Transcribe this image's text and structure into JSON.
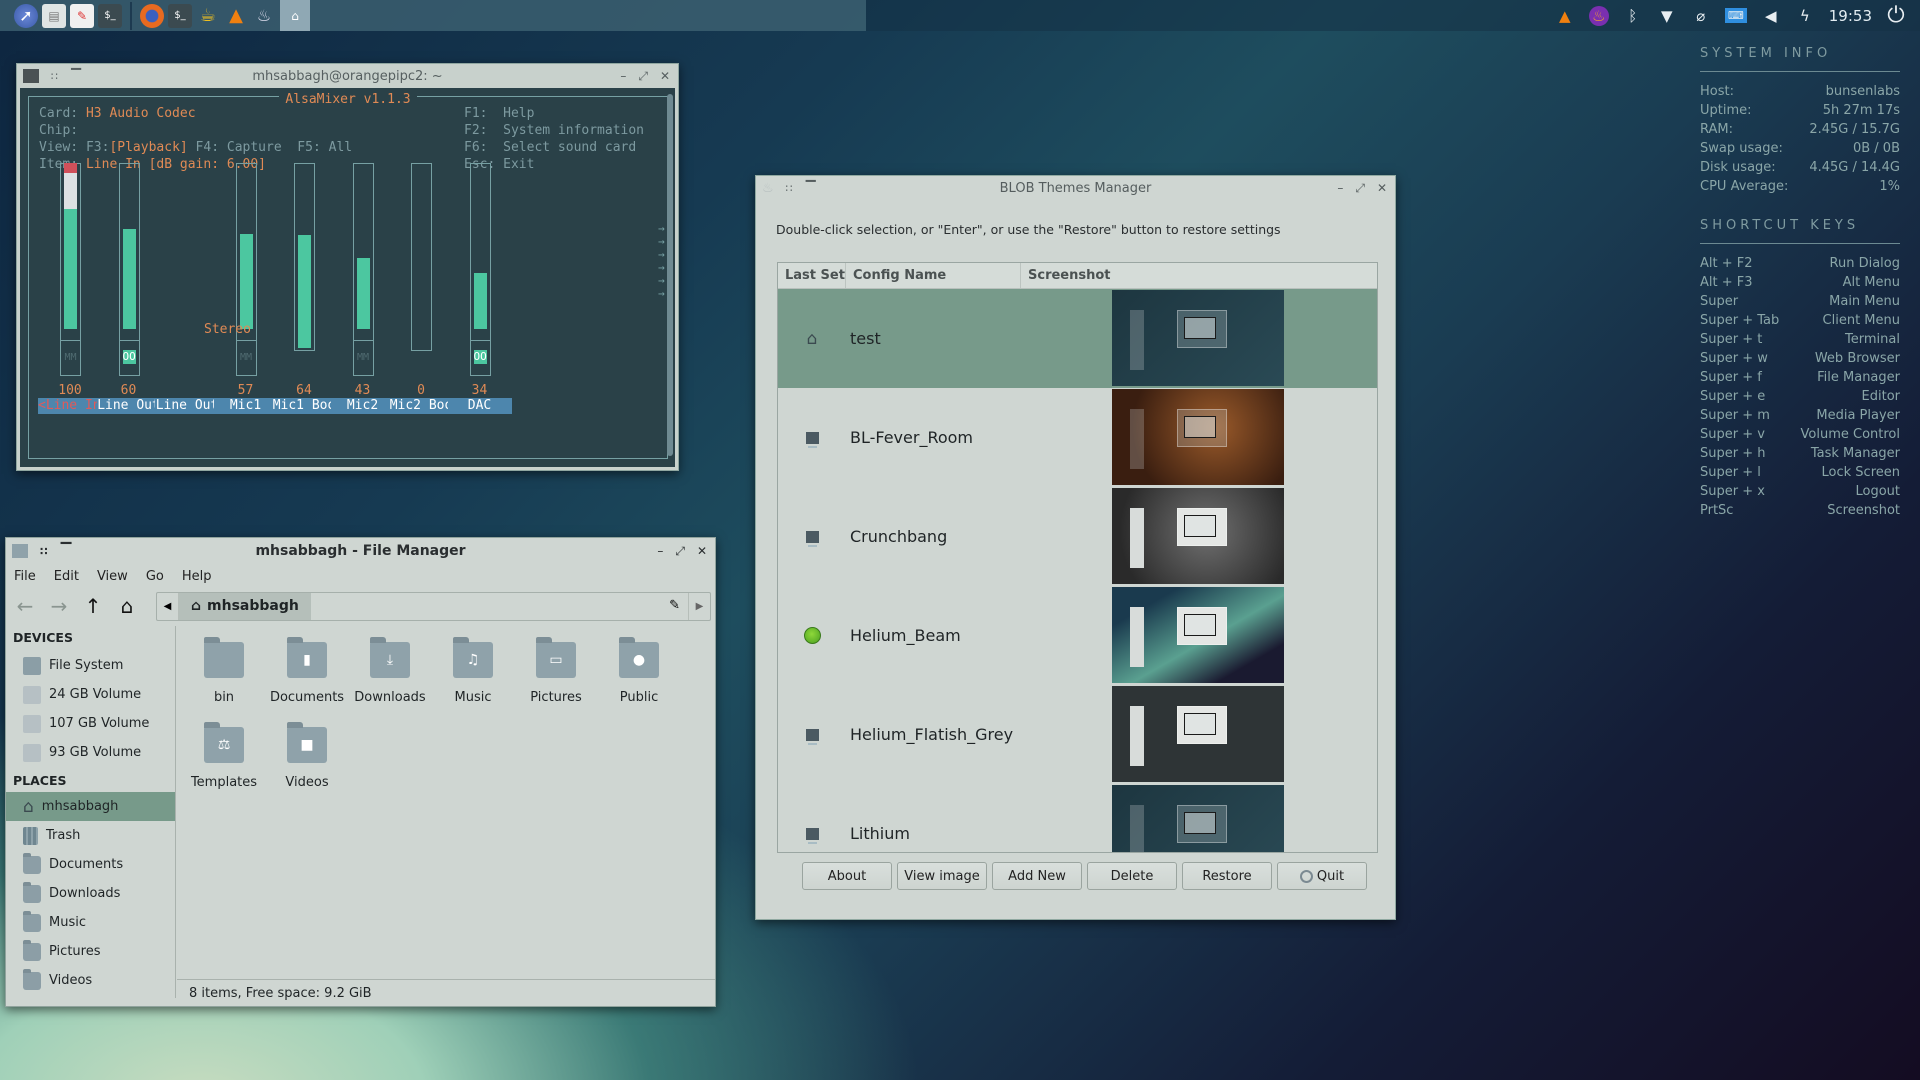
{
  "taskbar": {
    "launchers": [
      "web-browser-icon",
      "file-manager-icon",
      "text-editor-icon",
      "terminal-icon"
    ],
    "apps": [
      "firefox-icon",
      "terminal-icon",
      "conky-icon",
      "vlc-icon",
      "blob-icon",
      "file-manager-icon"
    ],
    "tray": [
      "vlc-icon",
      "flame-app-icon",
      "bluetooth-icon",
      "wifi-icon",
      "clipboard-icon",
      "keyboard-icon",
      "volume-icon",
      "power-manager-icon"
    ],
    "clock": "19:53"
  },
  "conky": {
    "system_title": "SYSTEM INFO",
    "system": [
      {
        "k": "Host:",
        "v": "bunsenlabs"
      },
      {
        "k": "Uptime:",
        "v": "5h 27m 17s"
      },
      {
        "k": "RAM:",
        "v": "2.45G / 15.7G"
      },
      {
        "k": "Swap usage:",
        "v": "0B / 0B"
      },
      {
        "k": "Disk usage:",
        "v": "4.45G / 14.4G"
      },
      {
        "k": "CPU Average:",
        "v": "1%"
      }
    ],
    "shortcuts_title": "SHORTCUT KEYS",
    "shortcuts": [
      {
        "k": "Alt + F2",
        "v": "Run Dialog"
      },
      {
        "k": "Alt + F3",
        "v": "Alt Menu"
      },
      {
        "k": "Super",
        "v": "Main Menu"
      },
      {
        "k": "Super + Tab",
        "v": "Client Menu"
      },
      {
        "k": "Super + t",
        "v": "Terminal"
      },
      {
        "k": "Super + w",
        "v": "Web Browser"
      },
      {
        "k": "Super + f",
        "v": "File Manager"
      },
      {
        "k": "Super + e",
        "v": "Editor"
      },
      {
        "k": "Super + m",
        "v": "Media Player"
      },
      {
        "k": "Super + v",
        "v": "Volume Control"
      },
      {
        "k": "Super + h",
        "v": "Task Manager"
      },
      {
        "k": "Super + l",
        "v": "Lock Screen"
      },
      {
        "k": "Super + x",
        "v": "Logout"
      },
      {
        "k": "PrtSc",
        "v": "Screenshot"
      }
    ]
  },
  "alsa": {
    "window_title": "mhsabbagh@orangepipc2: ~",
    "app_title": "AlsaMixer v1.1.3",
    "card_label": "Card: ",
    "card": "H3 Audio Codec",
    "chip_label": "Chip:",
    "view_label": "View: F3:",
    "view_playback": "[Playback]",
    "view_rest": " F4: Capture  F5: All",
    "item_label": "Item: ",
    "item": "Line In [dB gain: 6.00]",
    "help": [
      "F1:  Help",
      "F2:  System information",
      "F6:  Select sound card",
      "Esc: Exit"
    ],
    "stereo": "Stereo",
    "channels": [
      {
        "name": "<Line In >",
        "level": 100,
        "display": "100",
        "mute": "MM",
        "selected": true
      },
      {
        "name": "Line Out",
        "level": 60,
        "display": "60",
        "mute": "OO"
      },
      {
        "name": "Line Out",
        "level": null,
        "display": "",
        "mute": null
      },
      {
        "name": "Mic1",
        "level": 57,
        "display": "57",
        "mute": "MM"
      },
      {
        "name": "Mic1 Boo",
        "level": 64,
        "display": "64",
        "mute": null
      },
      {
        "name": "Mic2",
        "level": 43,
        "display": "43",
        "mute": "MM"
      },
      {
        "name": "Mic2 Boo",
        "level": 0,
        "display": "0",
        "mute": null
      },
      {
        "name": "DAC",
        "level": 34,
        "display": "34",
        "mute": "OO"
      }
    ]
  },
  "blob": {
    "window_title": "BLOB Themes Manager",
    "hint": "Double-click selection, or \"Enter\", or use the \"Restore\" button to restore settings",
    "columns": [
      "Last Set",
      "Config Name",
      "Screenshot"
    ],
    "rows": [
      {
        "marker": "home-icon",
        "name": "test",
        "theme": "teal",
        "selected": true
      },
      {
        "marker": "monitor-icon",
        "name": "BL-Fever_Room",
        "theme": "orange"
      },
      {
        "marker": "monitor-icon",
        "name": "Crunchbang",
        "theme": "grey"
      },
      {
        "marker": "green-dot-icon",
        "name": "Helium_Beam",
        "theme": "beam"
      },
      {
        "marker": "monitor-icon",
        "name": "Helium_Flatish_Grey",
        "theme": "dark"
      },
      {
        "marker": "monitor-icon",
        "name": "Lithium",
        "theme": "teal"
      }
    ],
    "buttons": [
      "About",
      "View image",
      "Add New",
      "Delete",
      "Restore",
      "Quit"
    ]
  },
  "fm": {
    "window_title": "mhsabbagh - File Manager",
    "menu": [
      "File",
      "Edit",
      "View",
      "Go",
      "Help"
    ],
    "path": "mhsabbagh",
    "devices_title": "DEVICES",
    "devices": [
      "File System",
      "24 GB Volume",
      "107 GB Volume",
      "93 GB Volume"
    ],
    "places_title": "PLACES",
    "places": [
      "mhsabbagh",
      "Trash",
      "Documents",
      "Downloads",
      "Music",
      "Pictures",
      "Videos"
    ],
    "items": [
      {
        "name": "bin",
        "glyph": ""
      },
      {
        "name": "Documents",
        "glyph": "▮"
      },
      {
        "name": "Downloads",
        "glyph": "⤓"
      },
      {
        "name": "Music",
        "glyph": "♫"
      },
      {
        "name": "Pictures",
        "glyph": "▭"
      },
      {
        "name": "Public",
        "glyph": "●"
      },
      {
        "name": "Templates",
        "glyph": "⚖"
      },
      {
        "name": "Videos",
        "glyph": "■"
      }
    ],
    "status": "8 items, Free space: 9.2 GiB"
  }
}
